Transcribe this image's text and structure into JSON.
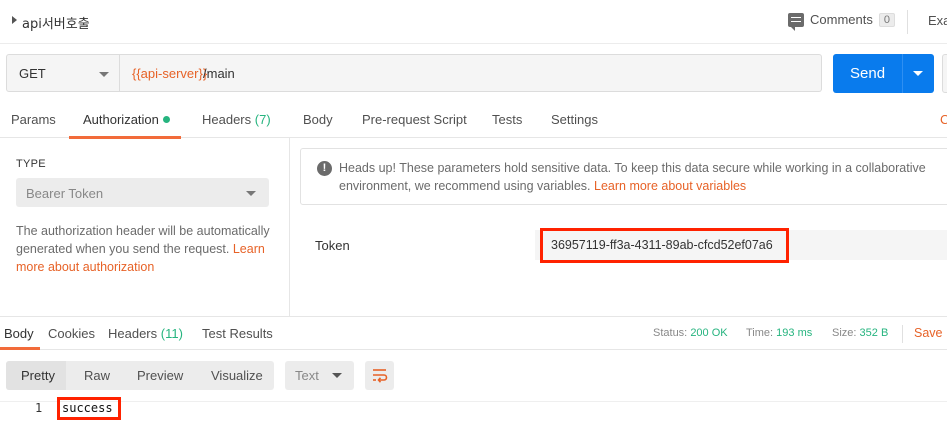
{
  "request": {
    "name": "api서버호출",
    "comments_label": "Comments",
    "comments_count": "0",
    "examples_label": "Exa",
    "method": "GET",
    "url_variable": "{{api-server}}",
    "url_path": "/main",
    "send_label": "Send"
  },
  "request_tabs": {
    "params": "Params",
    "authorization": "Authorization",
    "headers": "Headers",
    "headers_count": "(7)",
    "body": "Body",
    "prerequest": "Pre-request Script",
    "tests": "Tests",
    "settings": "Settings",
    "cookies_edge": "C"
  },
  "auth": {
    "type_label": "TYPE",
    "type_value": "Bearer Token",
    "description": "The authorization header will be automatically generated when you send the request.",
    "learn_more": "Learn more about authorization",
    "notice_text": "Heads up! These parameters hold sensitive data. To keep this data secure while working in a collaborative environment, we recommend using variables.",
    "notice_link": "Learn more about variables",
    "token_label": "Token",
    "token_value": "36957119-ff3a-4311-89ab-cfcd52ef07a6"
  },
  "response_tabs": {
    "body": "Body",
    "cookies": "Cookies",
    "headers": "Headers",
    "headers_count": "(11)",
    "test_results": "Test Results"
  },
  "response_status": {
    "status_label": "Status:",
    "status_value": "200 OK",
    "time_label": "Time:",
    "time_value": "193 ms",
    "size_label": "Size:",
    "size_value": "352 B",
    "save_label": "Save I"
  },
  "response_view": {
    "pretty": "Pretty",
    "raw": "Raw",
    "preview": "Preview",
    "visualize": "Visualize",
    "language": "Text",
    "line_number": "1",
    "body_text": "success"
  },
  "colors": {
    "accent_orange": "#e76227",
    "send_blue": "#097bed",
    "status_green": "#26b47f",
    "highlight_red": "#ff2200"
  }
}
